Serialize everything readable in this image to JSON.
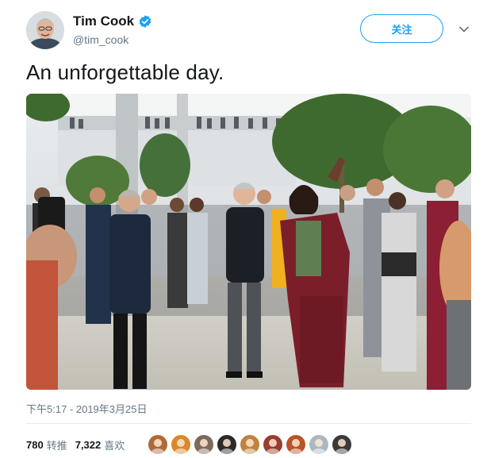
{
  "tweet": {
    "author": {
      "display_name": "Tim Cook",
      "handle": "@tim_cook",
      "verified": true,
      "avatar_icon": "user-avatar-photo"
    },
    "follow_label": "关注",
    "menu_icon": "chevron-down-icon",
    "text": "An unforgettable day.",
    "photo_icon": "crowd-photo",
    "timestamp": "下午5:17 - 2019年3月25日",
    "stats": {
      "retweets_count": "780",
      "retweets_label": "转推",
      "likes_count": "7,322",
      "likes_label": "喜欢"
    },
    "likers": [
      {
        "icon": "liker-avatar",
        "color": "#b06a3a"
      },
      {
        "icon": "liker-avatar",
        "color": "#d9882b"
      },
      {
        "icon": "liker-avatar",
        "color": "#7d6a5a"
      },
      {
        "icon": "liker-avatar",
        "color": "#2b2b2b"
      },
      {
        "icon": "liker-avatar",
        "color": "#c0833f"
      },
      {
        "icon": "liker-avatar",
        "color": "#9a3d2e"
      },
      {
        "icon": "liker-avatar",
        "color": "#b8542a"
      },
      {
        "icon": "liker-avatar",
        "color": "#aab8c2"
      },
      {
        "icon": "liker-avatar",
        "color": "#3a3a3a"
      }
    ]
  },
  "colors": {
    "accent": "#1da1f2",
    "text": "#14171a",
    "muted": "#657786"
  }
}
